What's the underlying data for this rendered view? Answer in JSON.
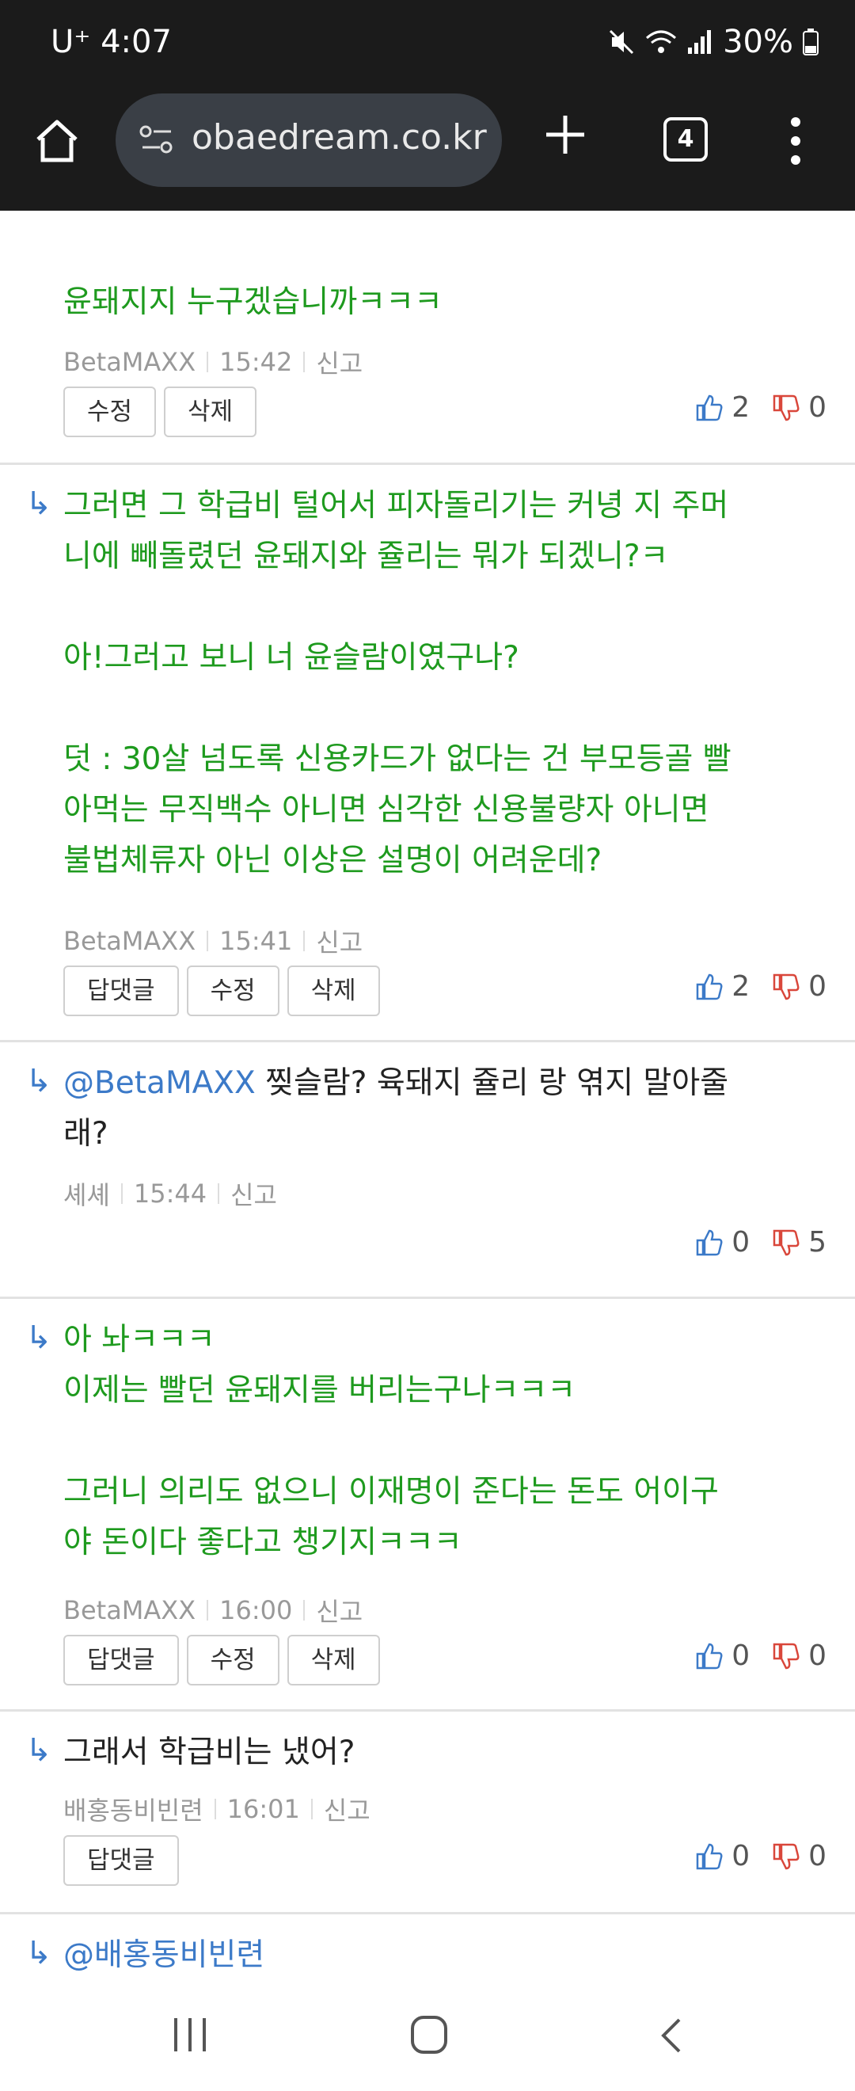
{
  "status": {
    "carrier": "U⁺ 4:07",
    "battery": "30%"
  },
  "browser": {
    "url": "obaedream.co.kr",
    "tab_count": "4"
  },
  "comments": [
    {
      "text": "윤돼지지 누구겠습니까ㅋㅋㅋ",
      "author": "BetaMAXX",
      "time": "15:42",
      "report": "신고",
      "buttons": [
        "수정",
        "삭제"
      ],
      "up": "2",
      "down": "0"
    },
    {
      "text": "그러면 그 학급비 털어서 피자돌리기는 커녕 지 주머\n니에 빼돌렸던 윤돼지와 쥴리는 뭐가 되겠니?ㅋ\n\n아!그러고 보니 너 윤슬람이였구나?\n\n덧 : 30살 넘도록 신용카드가 없다는 건 부모등골 빨\n아먹는 무직백수 아니면 심각한 신용불량자 아니면\n불법체류자 아닌 이상은 설명이 어려운데?",
      "author": "BetaMAXX",
      "time": "15:41",
      "report": "신고",
      "buttons": [
        "답댓글",
        "수정",
        "삭제"
      ],
      "up": "2",
      "down": "0"
    },
    {
      "mention": "@BetaMAXX",
      "text": "  찢슬람? 육돼지 쥴리 랑 엮지 말아줄\n래?",
      "author": "셰셰",
      "time": "15:44",
      "report": "신고",
      "up": "0",
      "down": "5"
    },
    {
      "text": "아 놔ㅋㅋㅋ\n이제는 빨던 윤돼지를 버리는구나ㅋㅋㅋ\n\n그러니 의리도 없으니 이재명이 준다는 돈도 어이구\n야 돈이다 좋다고 챙기지ㅋㅋㅋ",
      "author": "BetaMAXX",
      "time": "16:00",
      "report": "신고",
      "buttons": [
        "답댓글",
        "수정",
        "삭제"
      ],
      "up": "0",
      "down": "0"
    },
    {
      "text": "그래서 학급비는 냈어?",
      "author": "배홍동비빈련",
      "time": "16:01",
      "report": "신고",
      "buttons": [
        "답댓글"
      ],
      "up": "0",
      "down": "0"
    },
    {
      "mention": "@배홍동비빈련"
    }
  ],
  "icons": {
    "reply_arrow": "↳",
    "thumb_up_color": "#3c7ac8",
    "thumb_down_color": "#d9473b"
  }
}
